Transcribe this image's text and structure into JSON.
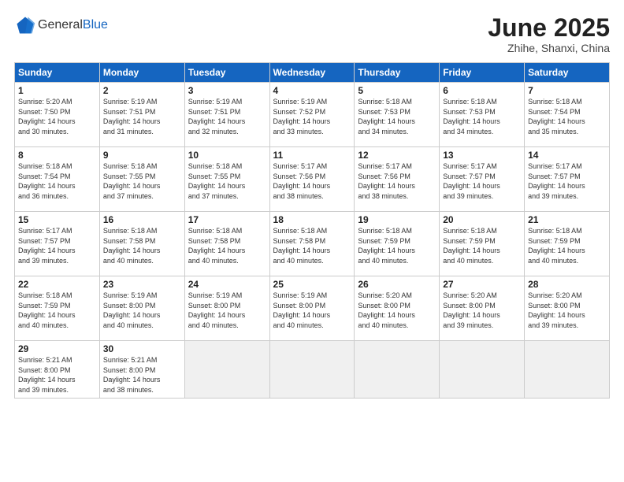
{
  "header": {
    "logo_general": "General",
    "logo_blue": "Blue",
    "month_year": "June 2025",
    "location": "Zhihe, Shanxi, China"
  },
  "weekdays": [
    "Sunday",
    "Monday",
    "Tuesday",
    "Wednesday",
    "Thursday",
    "Friday",
    "Saturday"
  ],
  "weeks": [
    [
      {
        "day": "1",
        "info": "Sunrise: 5:20 AM\nSunset: 7:50 PM\nDaylight: 14 hours\nand 30 minutes."
      },
      {
        "day": "2",
        "info": "Sunrise: 5:19 AM\nSunset: 7:51 PM\nDaylight: 14 hours\nand 31 minutes."
      },
      {
        "day": "3",
        "info": "Sunrise: 5:19 AM\nSunset: 7:51 PM\nDaylight: 14 hours\nand 32 minutes."
      },
      {
        "day": "4",
        "info": "Sunrise: 5:19 AM\nSunset: 7:52 PM\nDaylight: 14 hours\nand 33 minutes."
      },
      {
        "day": "5",
        "info": "Sunrise: 5:18 AM\nSunset: 7:53 PM\nDaylight: 14 hours\nand 34 minutes."
      },
      {
        "day": "6",
        "info": "Sunrise: 5:18 AM\nSunset: 7:53 PM\nDaylight: 14 hours\nand 34 minutes."
      },
      {
        "day": "7",
        "info": "Sunrise: 5:18 AM\nSunset: 7:54 PM\nDaylight: 14 hours\nand 35 minutes."
      }
    ],
    [
      {
        "day": "8",
        "info": "Sunrise: 5:18 AM\nSunset: 7:54 PM\nDaylight: 14 hours\nand 36 minutes."
      },
      {
        "day": "9",
        "info": "Sunrise: 5:18 AM\nSunset: 7:55 PM\nDaylight: 14 hours\nand 37 minutes."
      },
      {
        "day": "10",
        "info": "Sunrise: 5:18 AM\nSunset: 7:55 PM\nDaylight: 14 hours\nand 37 minutes."
      },
      {
        "day": "11",
        "info": "Sunrise: 5:17 AM\nSunset: 7:56 PM\nDaylight: 14 hours\nand 38 minutes."
      },
      {
        "day": "12",
        "info": "Sunrise: 5:17 AM\nSunset: 7:56 PM\nDaylight: 14 hours\nand 38 minutes."
      },
      {
        "day": "13",
        "info": "Sunrise: 5:17 AM\nSunset: 7:57 PM\nDaylight: 14 hours\nand 39 minutes."
      },
      {
        "day": "14",
        "info": "Sunrise: 5:17 AM\nSunset: 7:57 PM\nDaylight: 14 hours\nand 39 minutes."
      }
    ],
    [
      {
        "day": "15",
        "info": "Sunrise: 5:17 AM\nSunset: 7:57 PM\nDaylight: 14 hours\nand 39 minutes."
      },
      {
        "day": "16",
        "info": "Sunrise: 5:18 AM\nSunset: 7:58 PM\nDaylight: 14 hours\nand 40 minutes."
      },
      {
        "day": "17",
        "info": "Sunrise: 5:18 AM\nSunset: 7:58 PM\nDaylight: 14 hours\nand 40 minutes."
      },
      {
        "day": "18",
        "info": "Sunrise: 5:18 AM\nSunset: 7:58 PM\nDaylight: 14 hours\nand 40 minutes."
      },
      {
        "day": "19",
        "info": "Sunrise: 5:18 AM\nSunset: 7:59 PM\nDaylight: 14 hours\nand 40 minutes."
      },
      {
        "day": "20",
        "info": "Sunrise: 5:18 AM\nSunset: 7:59 PM\nDaylight: 14 hours\nand 40 minutes."
      },
      {
        "day": "21",
        "info": "Sunrise: 5:18 AM\nSunset: 7:59 PM\nDaylight: 14 hours\nand 40 minutes."
      }
    ],
    [
      {
        "day": "22",
        "info": "Sunrise: 5:18 AM\nSunset: 7:59 PM\nDaylight: 14 hours\nand 40 minutes."
      },
      {
        "day": "23",
        "info": "Sunrise: 5:19 AM\nSunset: 8:00 PM\nDaylight: 14 hours\nand 40 minutes."
      },
      {
        "day": "24",
        "info": "Sunrise: 5:19 AM\nSunset: 8:00 PM\nDaylight: 14 hours\nand 40 minutes."
      },
      {
        "day": "25",
        "info": "Sunrise: 5:19 AM\nSunset: 8:00 PM\nDaylight: 14 hours\nand 40 minutes."
      },
      {
        "day": "26",
        "info": "Sunrise: 5:20 AM\nSunset: 8:00 PM\nDaylight: 14 hours\nand 40 minutes."
      },
      {
        "day": "27",
        "info": "Sunrise: 5:20 AM\nSunset: 8:00 PM\nDaylight: 14 hours\nand 39 minutes."
      },
      {
        "day": "28",
        "info": "Sunrise: 5:20 AM\nSunset: 8:00 PM\nDaylight: 14 hours\nand 39 minutes."
      }
    ],
    [
      {
        "day": "29",
        "info": "Sunrise: 5:21 AM\nSunset: 8:00 PM\nDaylight: 14 hours\nand 39 minutes."
      },
      {
        "day": "30",
        "info": "Sunrise: 5:21 AM\nSunset: 8:00 PM\nDaylight: 14 hours\nand 38 minutes."
      },
      {
        "day": "",
        "info": ""
      },
      {
        "day": "",
        "info": ""
      },
      {
        "day": "",
        "info": ""
      },
      {
        "day": "",
        "info": ""
      },
      {
        "day": "",
        "info": ""
      }
    ]
  ]
}
